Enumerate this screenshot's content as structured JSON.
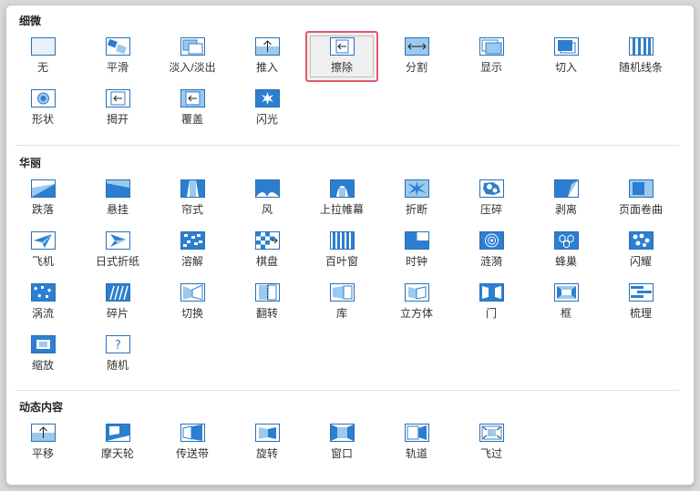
{
  "sections": [
    {
      "title": "细微",
      "items": [
        {
          "label": "无",
          "icon": "none-icon"
        },
        {
          "label": "平滑",
          "icon": "smooth-icon"
        },
        {
          "label": "淡入/淡出",
          "icon": "fade-icon"
        },
        {
          "label": "推入",
          "icon": "push-icon"
        },
        {
          "label": "擦除",
          "icon": "wipe-icon",
          "selected": true
        },
        {
          "label": "分割",
          "icon": "split-icon"
        },
        {
          "label": "显示",
          "icon": "reveal-icon"
        },
        {
          "label": "切入",
          "icon": "cut-icon"
        },
        {
          "label": "随机线条",
          "icon": "random-bars-icon"
        },
        {
          "label": "形状",
          "icon": "shape-icon"
        },
        {
          "label": "揭开",
          "icon": "uncover-icon"
        },
        {
          "label": "覆盖",
          "icon": "cover-icon"
        },
        {
          "label": "闪光",
          "icon": "flash-icon"
        }
      ]
    },
    {
      "title": "华丽",
      "items": [
        {
          "label": "跌落",
          "icon": "fall-over-icon"
        },
        {
          "label": "悬挂",
          "icon": "drape-icon"
        },
        {
          "label": "帘式",
          "icon": "curtains-icon"
        },
        {
          "label": "风",
          "icon": "wind-icon"
        },
        {
          "label": "上拉帷幕",
          "icon": "prestige-icon"
        },
        {
          "label": "折断",
          "icon": "fracture-icon"
        },
        {
          "label": "压碎",
          "icon": "crush-icon"
        },
        {
          "label": "剥离",
          "icon": "peel-off-icon"
        },
        {
          "label": "页面卷曲",
          "icon": "page-curl-icon"
        },
        {
          "label": "飞机",
          "icon": "airplane-icon"
        },
        {
          "label": "日式折纸",
          "icon": "origami-icon"
        },
        {
          "label": "溶解",
          "icon": "dissolve-icon"
        },
        {
          "label": "棋盘",
          "icon": "checkerboard-icon"
        },
        {
          "label": "百叶窗",
          "icon": "blinds-icon"
        },
        {
          "label": "时钟",
          "icon": "clock-icon"
        },
        {
          "label": "涟漪",
          "icon": "ripple-icon"
        },
        {
          "label": "蜂巢",
          "icon": "honeycomb-icon"
        },
        {
          "label": "闪耀",
          "icon": "glitter-icon"
        },
        {
          "label": "涡流",
          "icon": "vortex-icon"
        },
        {
          "label": "碎片",
          "icon": "shred-icon"
        },
        {
          "label": "切换",
          "icon": "switch-icon"
        },
        {
          "label": "翻转",
          "icon": "flip-icon"
        },
        {
          "label": "库",
          "icon": "gallery-icon"
        },
        {
          "label": "立方体",
          "icon": "cube-icon"
        },
        {
          "label": "门",
          "icon": "doors-icon"
        },
        {
          "label": "框",
          "icon": "box-icon"
        },
        {
          "label": "梳理",
          "icon": "comb-icon"
        },
        {
          "label": "缩放",
          "icon": "zoom-icon"
        },
        {
          "label": "随机",
          "icon": "random-icon"
        }
      ]
    },
    {
      "title": "动态内容",
      "items": [
        {
          "label": "平移",
          "icon": "pan-icon"
        },
        {
          "label": "摩天轮",
          "icon": "ferris-wheel-icon"
        },
        {
          "label": "传送带",
          "icon": "conveyor-icon"
        },
        {
          "label": "旋转",
          "icon": "rotate-icon"
        },
        {
          "label": "窗口",
          "icon": "window-icon"
        },
        {
          "label": "轨道",
          "icon": "orbit-icon"
        },
        {
          "label": "飞过",
          "icon": "fly-through-icon"
        }
      ]
    }
  ],
  "colors": {
    "icon_border": "#2c6fb4",
    "icon_fill": "#2c7fd0",
    "icon_light": "#9cc9ee",
    "selection": "#e05a6e"
  }
}
